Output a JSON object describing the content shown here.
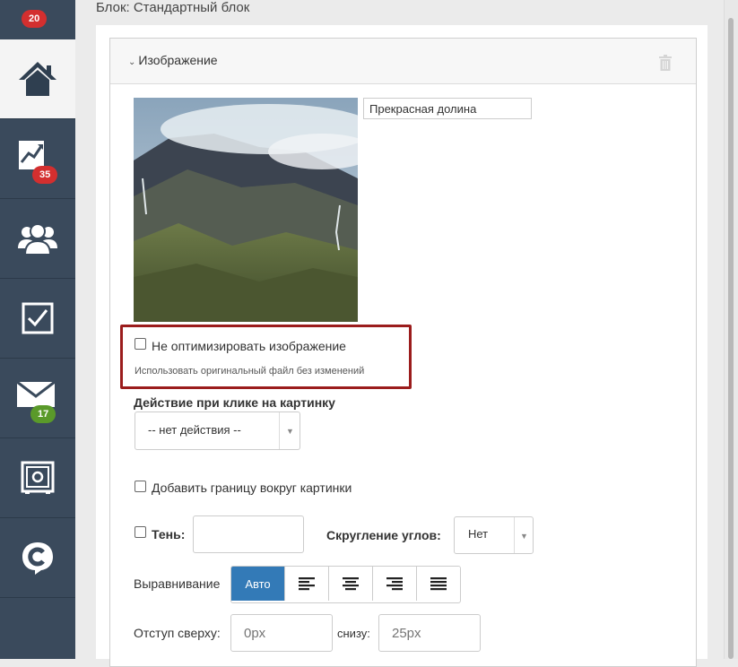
{
  "sidebar": {
    "items": [
      {
        "name": "notifications",
        "icon": "bell-icon",
        "badge": "20"
      },
      {
        "name": "home",
        "icon": "home-icon",
        "active": true
      },
      {
        "name": "stats",
        "icon": "chart-icon",
        "badge": "35"
      },
      {
        "name": "users",
        "icon": "users-icon"
      },
      {
        "name": "tasks",
        "icon": "checkbox-icon"
      },
      {
        "name": "mail",
        "icon": "mail-icon",
        "badge": "17"
      },
      {
        "name": "safe",
        "icon": "safe-icon"
      },
      {
        "name": "brand",
        "icon": "logo-c-icon"
      }
    ]
  },
  "block": {
    "title": "Блок: Стандартный блок"
  },
  "panel": {
    "title": "Изображение",
    "image_title_value": "Прекрасная долина",
    "no_optimize_label": "Не оптимизировать изображение",
    "no_optimize_hint": "Использовать оригинальный файл без изменений",
    "click_action_label": "Действие при клике на картинку",
    "click_action_value": "-- нет действия --",
    "border_label": "Добавить границу вокруг картинки",
    "shadow_label": "Тень:",
    "rounding_label": "Скругление углов:",
    "rounding_value": "Нет",
    "align_label": "Выравнивание",
    "align_auto": "Авто",
    "margin_top_label": "Отступ сверху:",
    "margin_top_placeholder": "0px",
    "margin_bottom_label": "снизу:",
    "margin_bottom_placeholder": "25px"
  },
  "colors": {
    "sidebar": "#3a4a5c",
    "accent": "#337ab7",
    "highlight": "#9b1c1c",
    "badge_red": "#d32f2f",
    "badge_green": "#5a9a2a"
  }
}
